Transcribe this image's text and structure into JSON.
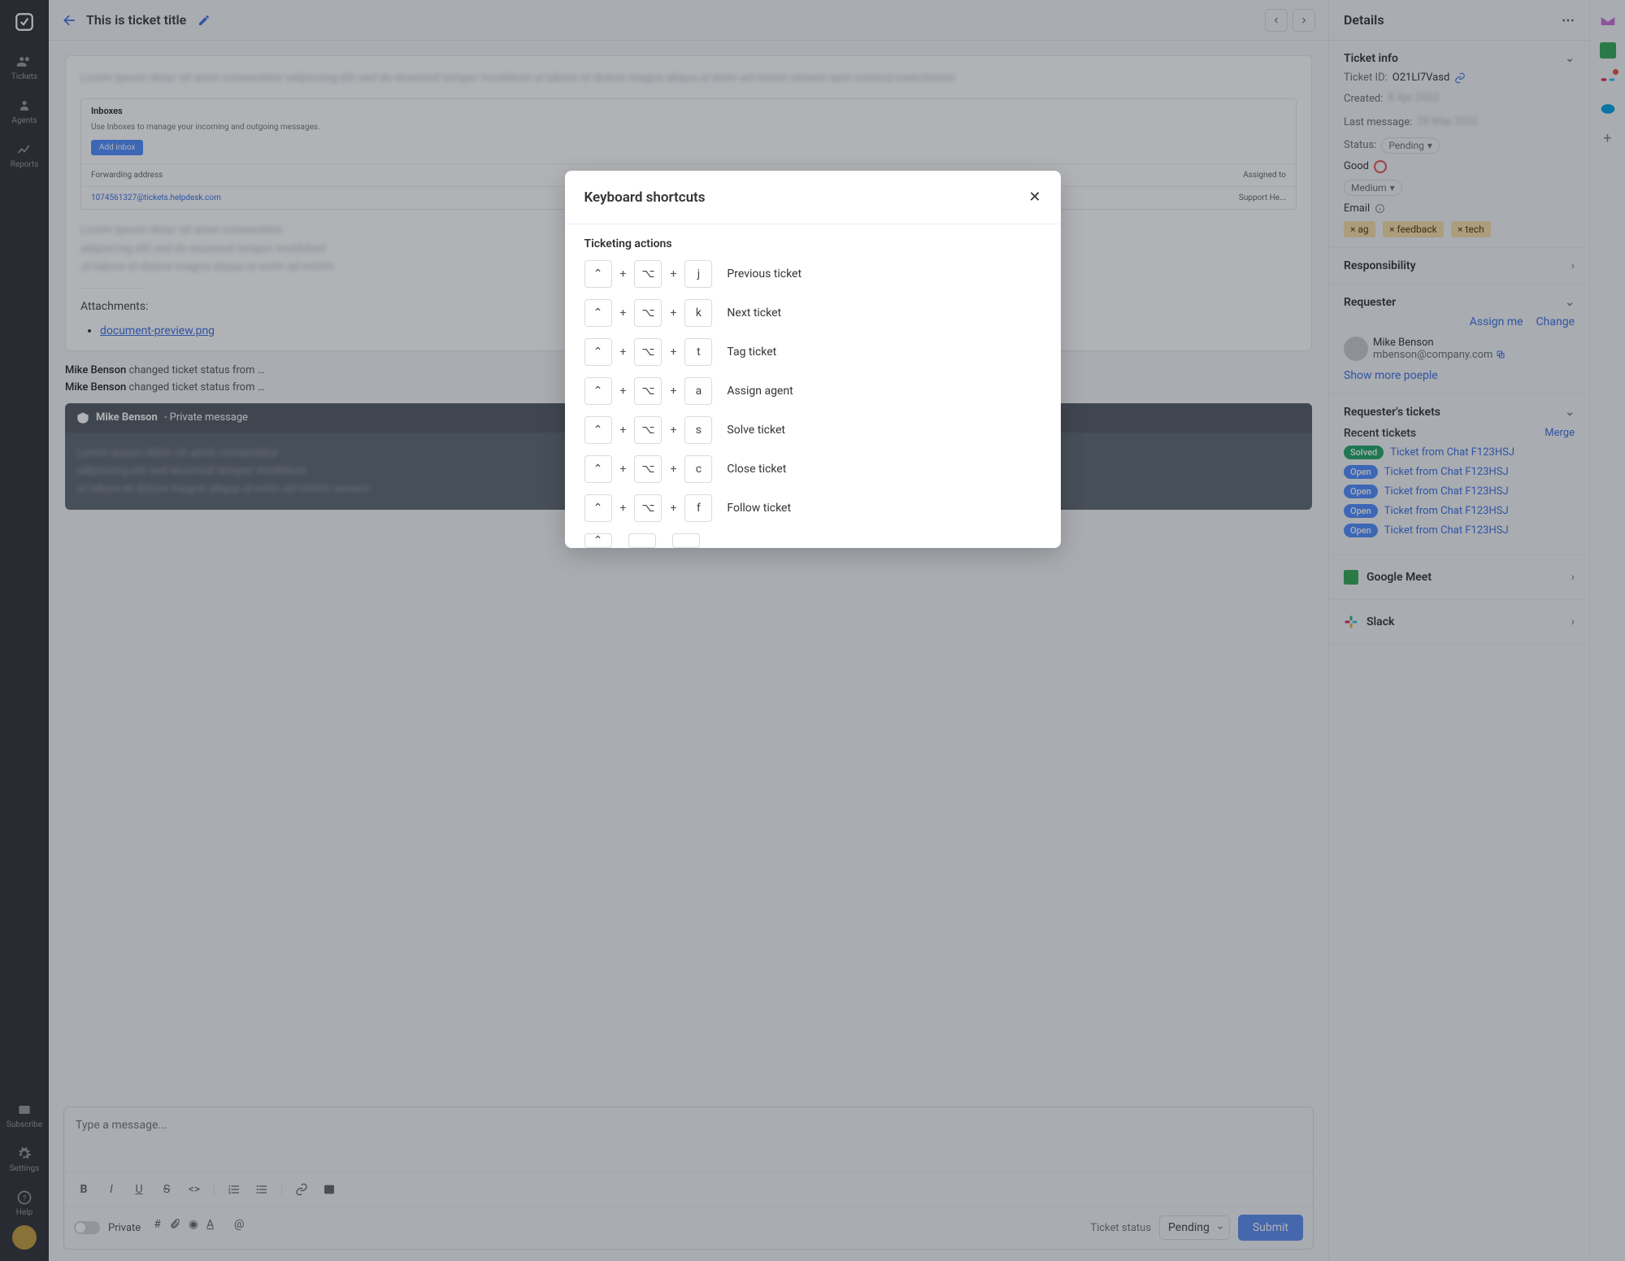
{
  "nav": {
    "items": [
      "Tickets",
      "Agents",
      "Reports"
    ],
    "bottom": [
      "Subscribe",
      "Settings",
      "Help"
    ]
  },
  "topbar": {
    "title": "This is ticket title"
  },
  "composer": {
    "placeholder": "Type a message...",
    "private_label": "Private",
    "status_label": "Ticket status",
    "status_value": "Pending",
    "submit": "Submit"
  },
  "card": {
    "inbox_title": "Inboxes",
    "inbox_sub": "Use Inboxes to manage your incoming and outgoing messages.",
    "add_inbox": "Add inbox",
    "fwd_col": "Forwarding address",
    "assigned_col": "Assigned to",
    "attachments_label": "Attachments:",
    "attachment_name": "document-preview.png"
  },
  "activity": {
    "name": "Mike Benson",
    "line": "changed ticket status from"
  },
  "private_msg": {
    "name": "Mike Benson",
    "suffix": " - Private message"
  },
  "details": {
    "header": "Details",
    "sections": {
      "info_title": "Ticket info",
      "ticket_id_label": "Ticket ID:",
      "ticket_id": "O21LI7Vasd",
      "created_label": "Created:",
      "last_msg_label": "Last message:",
      "status_label": "Status:",
      "status_value": "Pending",
      "good_label": "Good",
      "priority_value": "Medium",
      "source_value": "Email",
      "tags": [
        "ag",
        "feedback",
        "tech"
      ],
      "resp_title": "Responsibility",
      "requester_title": "Requester",
      "assign_me": "Assign me",
      "change": "Change",
      "req_name": "Mike Benson",
      "req_email": "mbenson@company.com",
      "more_people": "Show more poeple",
      "req_tickets_title": "Requester's tickets",
      "recent_title": "Recent tickets",
      "merge": "Merge",
      "tickets": [
        {
          "status": "Solved",
          "title": "Ticket from Chat F123HSJ"
        },
        {
          "status": "Open",
          "title": "Ticket from Chat F123HSJ"
        },
        {
          "status": "Open",
          "title": "Ticket from Chat F123HSJ"
        },
        {
          "status": "Open",
          "title": "Ticket from Chat F123HSJ"
        },
        {
          "status": "Open",
          "title": "Ticket from Chat F123HSJ"
        }
      ],
      "gmeet": "Google Meet",
      "slack": "Slack"
    }
  },
  "modal": {
    "title": "Keyboard shortcuts",
    "section_title": "Ticketing actions",
    "shortcuts": [
      {
        "key": "j",
        "label": "Previous ticket"
      },
      {
        "key": "k",
        "label": "Next ticket"
      },
      {
        "key": "t",
        "label": "Tag ticket"
      },
      {
        "key": "a",
        "label": "Assign agent"
      },
      {
        "key": "s",
        "label": "Solve ticket"
      },
      {
        "key": "c",
        "label": "Close ticket"
      },
      {
        "key": "f",
        "label": "Follow ticket"
      }
    ]
  }
}
